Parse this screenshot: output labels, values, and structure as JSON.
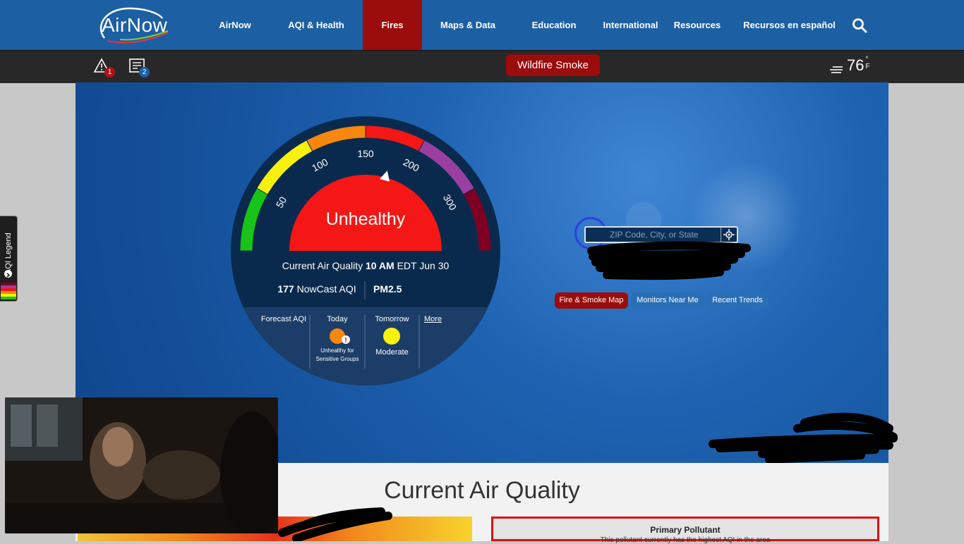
{
  "nav": {
    "logo_text": "AirNow",
    "items": [
      {
        "label": "AirNow"
      },
      {
        "label": "AQI & Health"
      },
      {
        "label": "Fires"
      },
      {
        "label": "Maps & Data"
      },
      {
        "label": "Education"
      },
      {
        "label": "International"
      },
      {
        "label": "Resources"
      },
      {
        "label": "Recursos en español"
      }
    ],
    "active": "Fires"
  },
  "subbar": {
    "alert_count": "1",
    "news_count": "2",
    "wildfire_label": "Wildfire Smoke",
    "temperature": "76",
    "temperature_unit": "°F"
  },
  "gauge": {
    "ticks": [
      "50",
      "100",
      "150",
      "200",
      "300"
    ],
    "category": "Unhealthy",
    "aqi_value": 177,
    "current_prefix": "Current Air Quality",
    "current_time": "10 AM",
    "current_tz_date": "EDT Jun 30",
    "nowcast_value": "177",
    "nowcast_label": "NowCast AQI",
    "pollutant": "PM2.5",
    "forecast_label": "Forecast AQI",
    "today_label": "Today",
    "today_category": "Unhealthy for Sensitive Groups",
    "today_color": "#f7870d",
    "tomorrow_label": "Tomorrow",
    "tomorrow_category": "Moderate",
    "tomorrow_color": "#f8f10d",
    "more_label": "More",
    "colors": {
      "good": "#18c418",
      "moderate": "#f8f10d",
      "usg": "#f7870d",
      "unhealthy": "#f51616",
      "very_unhealthy": "#9a3fa1",
      "hazardous": "#7e0023"
    }
  },
  "search": {
    "placeholder": "ZIP Code, City, or State"
  },
  "pills": [
    {
      "label": "Fire & Smoke Map",
      "color": "#9b0c0c"
    },
    {
      "label": "Monitors Near Me",
      "color": "#2a6fb5"
    },
    {
      "label": "Recent Trends",
      "color": "#2a6fb5"
    }
  ],
  "legend_tab": {
    "label": "AQI Legend"
  },
  "current_section": {
    "title": "Current Air Quality",
    "primary_title": "Primary Pollutant",
    "primary_sub": "This pollutant currently has the highest AQI in the area"
  },
  "colors": {
    "nav_bg": "#1d5fa3",
    "active_nav": "#9b0c0c",
    "subbar_bg": "#282828",
    "hero_bg": "#1e63b2"
  }
}
